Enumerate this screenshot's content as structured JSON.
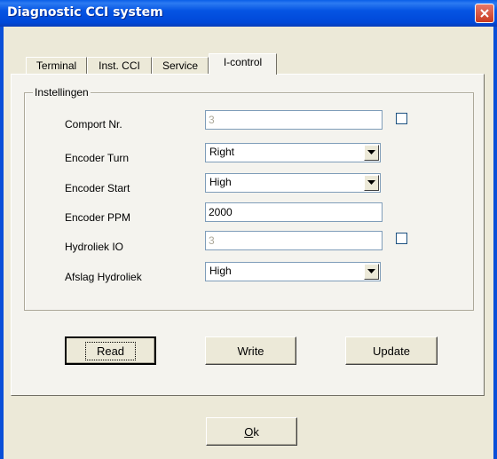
{
  "window": {
    "title": "Diagnostic CCI system"
  },
  "tabs": [
    {
      "label": "Terminal"
    },
    {
      "label": "Inst. CCI"
    },
    {
      "label": "Service"
    },
    {
      "label": "I-control"
    }
  ],
  "group": {
    "title": "Instellingen"
  },
  "fields": {
    "comport": {
      "label": "Comport Nr.",
      "value": "3"
    },
    "encoder_turn": {
      "label": "Encoder Turn",
      "value": "Right"
    },
    "encoder_start": {
      "label": "Encoder Start",
      "value": "High"
    },
    "encoder_ppm": {
      "label": "Encoder PPM",
      "value": "2000"
    },
    "hydroliek_io": {
      "label": "Hydroliek IO",
      "value": "3"
    },
    "afslag_hydroliek": {
      "label": "Afslag Hydroliek",
      "value": "High"
    }
  },
  "buttons": {
    "read": {
      "label": "Read"
    },
    "write": {
      "label": "Write"
    },
    "update": {
      "label": "Update"
    },
    "ok": {
      "label_first": "O",
      "label_rest": "k"
    }
  },
  "icons": {
    "close": "close-icon",
    "dropdown": "chevron-down-icon"
  }
}
